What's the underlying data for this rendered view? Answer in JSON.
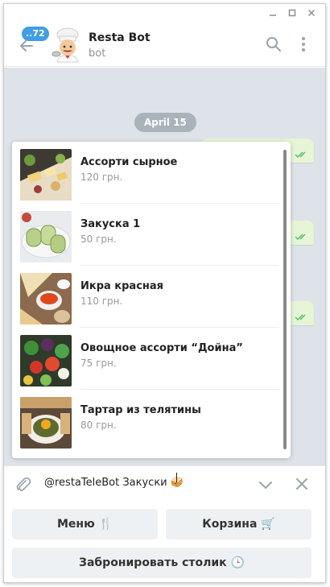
{
  "window": {
    "controls": [
      "minimize",
      "maximize",
      "close"
    ]
  },
  "header": {
    "back_badge": "..72",
    "title": "Resta Bot",
    "subtitle": "bot",
    "icons": [
      "search-icon",
      "more-vert-icon"
    ]
  },
  "chat": {
    "date": "April 15"
  },
  "inline_results": [
    {
      "title": "Ассорти сырное",
      "price": "120 грн.",
      "image": "cheese-platter"
    },
    {
      "title": "Закуска 1",
      "price": "50 грн.",
      "image": "zucchini-rolls"
    },
    {
      "title": "Икра красная",
      "price": "110 грн.",
      "image": "red-caviar"
    },
    {
      "title": "Овощное ассорти “Дойна”",
      "price": "75 грн.",
      "image": "vegetable-platter"
    },
    {
      "title": "Тартар из телятины",
      "price": "80 грн.",
      "image": "veal-tartare"
    }
  ],
  "input": {
    "text": "@restaTeleBot Закуски 🥪"
  },
  "keyboard": {
    "menu": "Меню 🍴",
    "cart": "Корзина 🛒",
    "reserve": "Забронировать столик 🕒"
  },
  "colors": {
    "accent": "#3f9ee5",
    "chat_bg": "#dde3e8",
    "outgoing_bubble": "#e5f5d6",
    "read_check": "#5dbb63"
  }
}
